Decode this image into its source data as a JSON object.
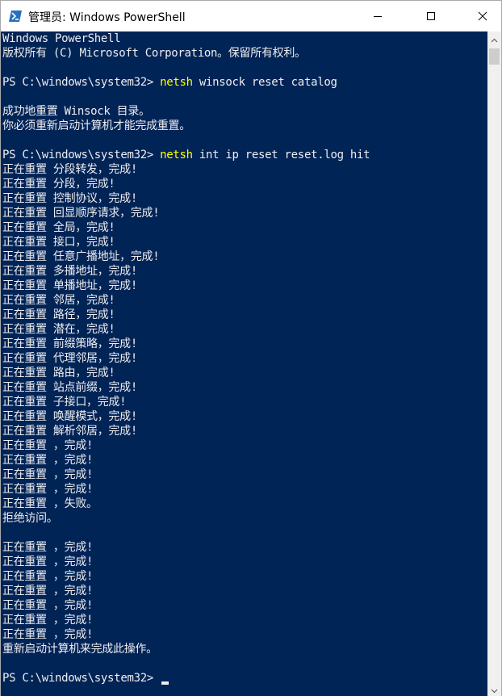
{
  "window": {
    "title": "管理员: Windows PowerShell"
  },
  "console": {
    "prompt": "PS C:\\windows\\system32> ",
    "lines": [
      {
        "text": "Windows PowerShell"
      },
      {
        "text": "版权所有 (C) Microsoft Corporation。保留所有权利。"
      },
      {
        "text": ""
      },
      {
        "prompt": true,
        "cmd": "netsh",
        "args": " winsock reset catalog"
      },
      {
        "text": ""
      },
      {
        "text": "成功地重置 Winsock 目录。"
      },
      {
        "text": "你必须重新启动计算机才能完成重置。"
      },
      {
        "text": ""
      },
      {
        "prompt": true,
        "cmd": "netsh",
        "args": " int ip reset reset.log hit"
      },
      {
        "text": "正在重置 分段转发，完成!"
      },
      {
        "text": "正在重置 分段，完成!"
      },
      {
        "text": "正在重置 控制协议，完成!"
      },
      {
        "text": "正在重置 回显顺序请求，完成!"
      },
      {
        "text": "正在重置 全局，完成!"
      },
      {
        "text": "正在重置 接口，完成!"
      },
      {
        "text": "正在重置 任意广播地址，完成!"
      },
      {
        "text": "正在重置 多播地址，完成!"
      },
      {
        "text": "正在重置 单播地址，完成!"
      },
      {
        "text": "正在重置 邻居，完成!"
      },
      {
        "text": "正在重置 路径，完成!"
      },
      {
        "text": "正在重置 潜在，完成!"
      },
      {
        "text": "正在重置 前缀策略，完成!"
      },
      {
        "text": "正在重置 代理邻居，完成!"
      },
      {
        "text": "正在重置 路由，完成!"
      },
      {
        "text": "正在重置 站点前缀，完成!"
      },
      {
        "text": "正在重置 子接口，完成!"
      },
      {
        "text": "正在重置 唤醒模式，完成!"
      },
      {
        "text": "正在重置 解析邻居，完成!"
      },
      {
        "text": "正在重置 ，完成!"
      },
      {
        "text": "正在重置 ，完成!"
      },
      {
        "text": "正在重置 ，完成!"
      },
      {
        "text": "正在重置 ，完成!"
      },
      {
        "text": "正在重置 ，失败。"
      },
      {
        "text": "拒绝访问。"
      },
      {
        "text": ""
      },
      {
        "text": "正在重置 ，完成!"
      },
      {
        "text": "正在重置 ，完成!"
      },
      {
        "text": "正在重置 ，完成!"
      },
      {
        "text": "正在重置 ，完成!"
      },
      {
        "text": "正在重置 ，完成!"
      },
      {
        "text": "正在重置 ，完成!"
      },
      {
        "text": "正在重置 ，完成!"
      },
      {
        "text": "重新启动计算机来完成此操作。"
      },
      {
        "text": ""
      },
      {
        "prompt": true,
        "cmd": "",
        "args": "",
        "cursor": true
      }
    ]
  },
  "colors": {
    "console_bg": "#012456",
    "console_fg": "#eeedf0",
    "command": "#ffff00"
  },
  "icons": {
    "app": "powershell-icon",
    "minimize": "minimize-icon",
    "maximize": "maximize-icon",
    "close": "close-icon",
    "scroll_up": "scroll-up-arrow-icon",
    "scroll_down": "scroll-down-arrow-icon"
  }
}
